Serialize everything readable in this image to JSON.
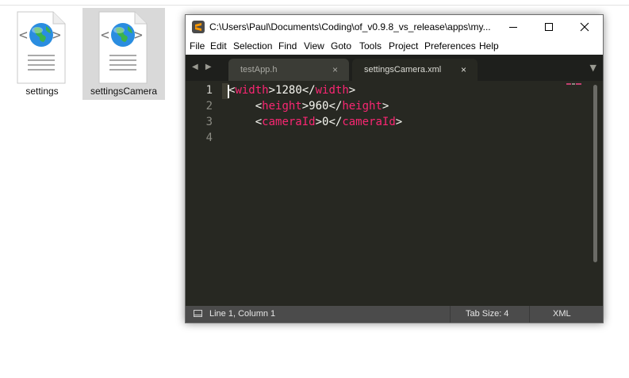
{
  "desktop": {
    "files": [
      {
        "label": "settings"
      },
      {
        "label": "settingsCamera"
      }
    ]
  },
  "window": {
    "title": "C:\\Users\\Paul\\Documents\\Coding\\of_v0.9.8_vs_release\\apps\\my...",
    "controls": {
      "minimize": "minimize-icon",
      "maximize": "maximize-icon",
      "close": "close-icon"
    }
  },
  "menu": [
    "File",
    "Edit",
    "Selection",
    "Find",
    "View",
    "Goto",
    "Tools",
    "Project",
    "Preferences",
    "Help"
  ],
  "tabs": [
    {
      "label": "testApp.h",
      "close": "×",
      "active": false
    },
    {
      "label": "settingsCamera.xml",
      "close": "×",
      "active": true
    }
  ],
  "nav": {
    "arrows": "◀ ▶",
    "dropdown": "▼"
  },
  "editor": {
    "line_numbers": [
      "1",
      "2",
      "3",
      "4"
    ],
    "lines": [
      {
        "open": "width",
        "value": "1280",
        "close": "width",
        "indent": ""
      },
      {
        "open": "height",
        "value": "960",
        "close": "height",
        "indent": "    "
      },
      {
        "open": "cameraId",
        "value": "0",
        "close": "cameraId",
        "indent": "    "
      },
      {
        "open": "",
        "value": "",
        "close": "",
        "indent": ""
      }
    ]
  },
  "status": {
    "position": "Line 1, Column 1",
    "tab_size": "Tab Size: 4",
    "syntax": "XML"
  },
  "colors": {
    "background": "#272822",
    "tag": "#f92672",
    "text": "#f8f8f2",
    "status_bar": "#4b4b4b"
  }
}
